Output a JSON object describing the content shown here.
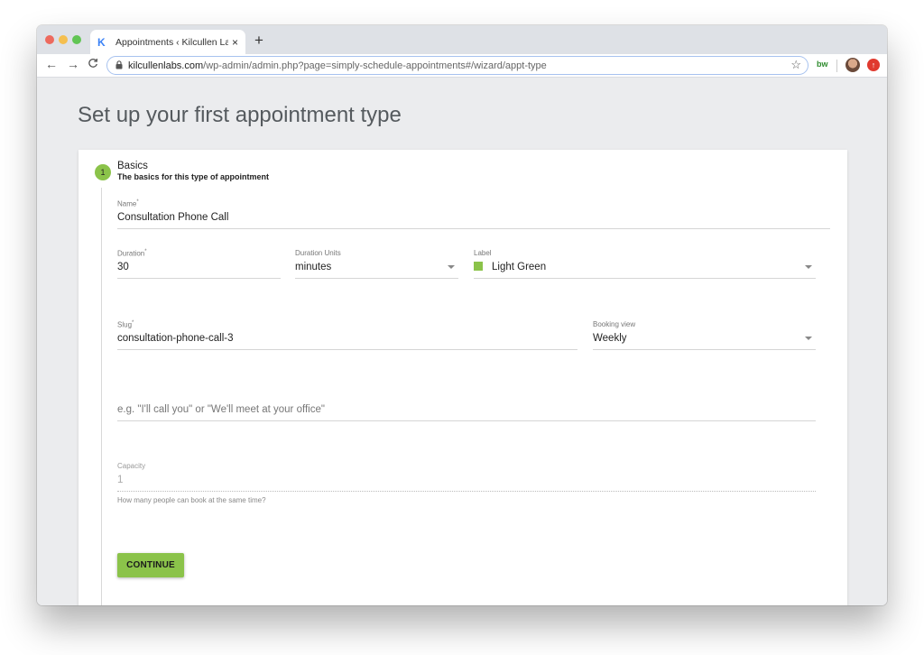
{
  "browser": {
    "tab": {
      "favicon": "K",
      "title": "Appointments ‹ Kilcullen Labs",
      "close_icon": "×"
    },
    "new_tab_icon": "+",
    "nav": {
      "back": "←",
      "forward": "→",
      "reload": "C"
    },
    "url": {
      "host": "kilcullenlabs.com",
      "path": "/wp-admin/admin.php?page=simply-schedule-appointments#/wizard/appt-type"
    },
    "bookmark_icon": "☆",
    "extension_bw": "bw",
    "extension_up": "↑"
  },
  "page": {
    "title": "Set up your first appointment type"
  },
  "step": {
    "number": "1",
    "title": "Basics",
    "subtitle": "The basics for this type of appointment"
  },
  "form": {
    "name": {
      "label": "Name",
      "required": "*",
      "value": "Consultation Phone Call"
    },
    "duration": {
      "label": "Duration",
      "required": "*",
      "value": "30"
    },
    "duration_units": {
      "label": "Duration Units",
      "value": "minutes"
    },
    "label": {
      "label": "Label",
      "value": "Light Green",
      "color": "#8bc34a"
    },
    "slug": {
      "label": "Slug",
      "required": "*",
      "value": "consultation-phone-call-3"
    },
    "booking_view": {
      "label": "Booking view",
      "value": "Weekly"
    },
    "location": {
      "placeholder": "e.g. \"I'll call you\" or \"We'll meet at your office\""
    },
    "capacity": {
      "label": "Capacity",
      "value": "1",
      "hint": "How many people can book at the same time?"
    },
    "continue_label": "CONTINUE"
  },
  "colors": {
    "accent": "#8bc34a"
  }
}
